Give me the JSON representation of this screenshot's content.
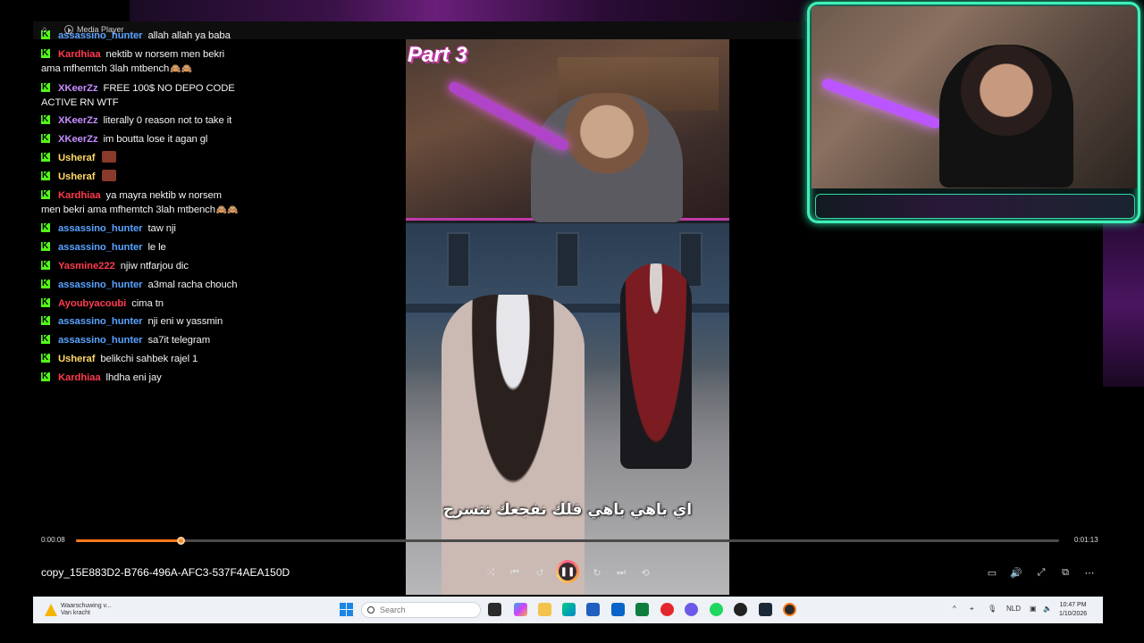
{
  "window": {
    "title": "Media Player"
  },
  "chat": [
    {
      "user": "assassino_hunter",
      "color": "#5aa2ff",
      "text": "allah allah ya baba",
      "extra": ""
    },
    {
      "user": "Kardhiaa",
      "color": "#ff3b4e",
      "text": "nektib w norsem men bekri ama mfhemtch 3lah mtbench",
      "extra": "🙈🙈"
    },
    {
      "user": "XKeerZz",
      "color": "#c58cff",
      "text": "FREE 100$ NO DEPO CODE ACTIVE RN WTF",
      "extra": ""
    },
    {
      "user": "XKeerZz",
      "color": "#c58cff",
      "text": "literally 0 reason not to take it",
      "extra": ""
    },
    {
      "user": "XKeerZz",
      "color": "#c58cff",
      "text": "im boutta lose it agan gl",
      "extra": ""
    },
    {
      "user": "Usheraf",
      "color": "#ffd966",
      "text": "",
      "extra": "emote"
    },
    {
      "user": "Usheraf",
      "color": "#ffd966",
      "text": "",
      "extra": "emote"
    },
    {
      "user": "Kardhiaa",
      "color": "#ff3b4e",
      "text": "ya mayra nektib w norsem men bekri ama mfhemtch 3lah mtbench",
      "extra": "🙈🙈"
    },
    {
      "user": "assassino_hunter",
      "color": "#5aa2ff",
      "text": "taw nji",
      "extra": ""
    },
    {
      "user": "assassino_hunter",
      "color": "#5aa2ff",
      "text": "le le",
      "extra": ""
    },
    {
      "user": "Yasmine222",
      "color": "#ff3b4e",
      "text": "njiw ntfarjou dic",
      "extra": ""
    },
    {
      "user": "assassino_hunter",
      "color": "#5aa2ff",
      "text": "a3mal racha chouch",
      "extra": ""
    },
    {
      "user": "Ayoubyacoubi",
      "color": "#ff3b4e",
      "text": "cima tn",
      "extra": ""
    },
    {
      "user": "assassino_hunter",
      "color": "#5aa2ff",
      "text": "nji eni w yassmin",
      "extra": ""
    },
    {
      "user": "assassino_hunter",
      "color": "#5aa2ff",
      "text": "sa7it telegram",
      "extra": ""
    },
    {
      "user": "Usheraf",
      "color": "#ffd966",
      "text": "belikchi sahbek rajel 1",
      "extra": ""
    },
    {
      "user": "Kardhiaa",
      "color": "#ff3b4e",
      "text": "lhdha eni jay",
      "extra": ""
    }
  ],
  "video": {
    "overlay_title": "Part 3",
    "subtitle": "اي باهي باهي قلك نفجعك تتسرح"
  },
  "player": {
    "current_time": "0:00:08",
    "total_time": "0:01:13",
    "progress": 0.106,
    "filename": "copy_15E883D2-B766-496A-AFC3-537F4AEA150D",
    "accent": "#ff7a1a"
  },
  "taskbar": {
    "notification_title": "Waarschuwing v...",
    "notification_sub": "Van kracht",
    "search_placeholder": "Search",
    "language": "NLD",
    "time": "10:47 PM",
    "date": "1/10/2026"
  }
}
